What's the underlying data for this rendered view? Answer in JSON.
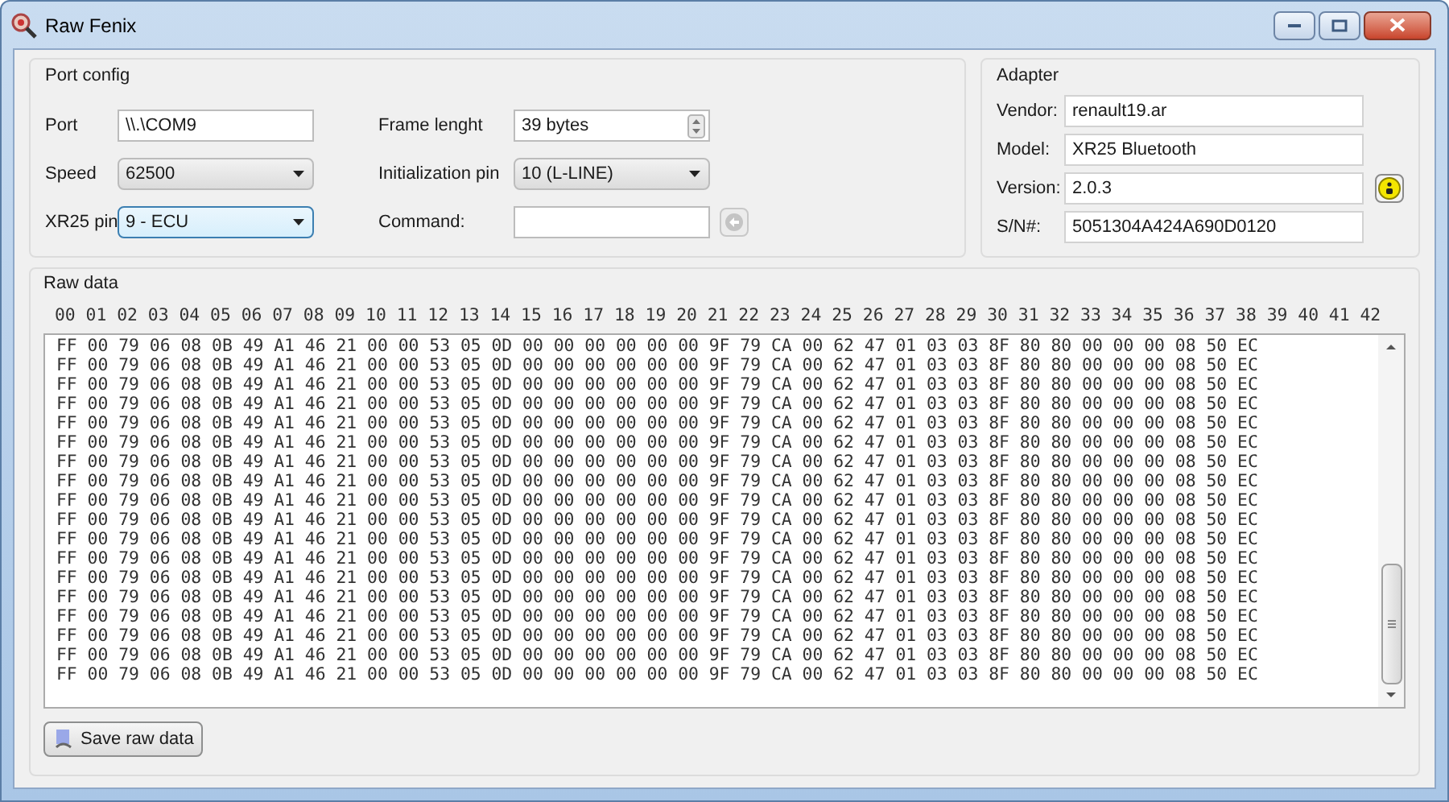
{
  "window": {
    "title": "Raw Fenix"
  },
  "port_config": {
    "title": "Port config",
    "fields": [
      {
        "label": "Port",
        "kind": "text",
        "value": "\\\\.\\COM9",
        "focused": false
      },
      {
        "label": "Frame lenght",
        "kind": "spin",
        "value": "39 bytes",
        "focused": false
      },
      {
        "label": "Speed",
        "kind": "dropdown",
        "value": "62500",
        "focused": false
      },
      {
        "label": "Initialization pin",
        "kind": "dropdown",
        "value": "10 (L-LINE)",
        "focused": false
      },
      {
        "label": "XR25 pin",
        "kind": "dropdown",
        "value": "9 - ECU",
        "focused": true
      },
      {
        "label": "Command:",
        "kind": "command",
        "focused": false,
        "disabled": true
      }
    ]
  },
  "adapter": {
    "title": "Adapter",
    "fields": [
      {
        "label": "Vendor:",
        "value": "renault19.ar"
      },
      {
        "label": "Model:",
        "value": "XR25 Bluetooth"
      },
      {
        "label": "Version:",
        "value": "2.0.3"
      },
      {
        "label": "S/N#:",
        "value": "5051304A424A690D0120"
      }
    ]
  },
  "raw_data": {
    "title": "Raw data",
    "header": "00 01 02 03 04 05 06 07 08 09 10 11 12 13 14 15 16 17 18 19 20 21 22 23 24 25 26 27 28 29 30 31 32 33 34 35 36 37 38 39 40 41 42",
    "rows": [
      "FF 00 79 06 08 0B 49 A1 46 21 00 00 53 05 0D 00 00 00 00 00 00 9F 79 CA 00 62 47 01 03 03 8F 80 80 00 00 00 08 50 EC",
      "FF 00 79 06 08 0B 49 A1 46 21 00 00 53 05 0D 00 00 00 00 00 00 9F 79 CA 00 62 47 01 03 03 8F 80 80 00 00 00 08 50 EC",
      "FF 00 79 06 08 0B 49 A1 46 21 00 00 53 05 0D 00 00 00 00 00 00 9F 79 CA 00 62 47 01 03 03 8F 80 80 00 00 00 08 50 EC",
      "FF 00 79 06 08 0B 49 A1 46 21 00 00 53 05 0D 00 00 00 00 00 00 9F 79 CA 00 62 47 01 03 03 8F 80 80 00 00 00 08 50 EC",
      "FF 00 79 06 08 0B 49 A1 46 21 00 00 53 05 0D 00 00 00 00 00 00 9F 79 CA 00 62 47 01 03 03 8F 80 80 00 00 00 08 50 EC",
      "FF 00 79 06 08 0B 49 A1 46 21 00 00 53 05 0D 00 00 00 00 00 00 9F 79 CA 00 62 47 01 03 03 8F 80 80 00 00 00 08 50 EC",
      "FF 00 79 06 08 0B 49 A1 46 21 00 00 53 05 0D 00 00 00 00 00 00 9F 79 CA 00 62 47 01 03 03 8F 80 80 00 00 00 08 50 EC",
      "FF 00 79 06 08 0B 49 A1 46 21 00 00 53 05 0D 00 00 00 00 00 00 9F 79 CA 00 62 47 01 03 03 8F 80 80 00 00 00 08 50 EC",
      "FF 00 79 06 08 0B 49 A1 46 21 00 00 53 05 0D 00 00 00 00 00 00 9F 79 CA 00 62 47 01 03 03 8F 80 80 00 00 00 08 50 EC",
      "FF 00 79 06 08 0B 49 A1 46 21 00 00 53 05 0D 00 00 00 00 00 00 9F 79 CA 00 62 47 01 03 03 8F 80 80 00 00 00 08 50 EC",
      "FF 00 79 06 08 0B 49 A1 46 21 00 00 53 05 0D 00 00 00 00 00 00 9F 79 CA 00 62 47 01 03 03 8F 80 80 00 00 00 08 50 EC",
      "FF 00 79 06 08 0B 49 A1 46 21 00 00 53 05 0D 00 00 00 00 00 00 9F 79 CA 00 62 47 01 03 03 8F 80 80 00 00 00 08 50 EC",
      "FF 00 79 06 08 0B 49 A1 46 21 00 00 53 05 0D 00 00 00 00 00 00 9F 79 CA 00 62 47 01 03 03 8F 80 80 00 00 00 08 50 EC",
      "FF 00 79 06 08 0B 49 A1 46 21 00 00 53 05 0D 00 00 00 00 00 00 9F 79 CA 00 62 47 01 03 03 8F 80 80 00 00 00 08 50 EC",
      "FF 00 79 06 08 0B 49 A1 46 21 00 00 53 05 0D 00 00 00 00 00 00 9F 79 CA 00 62 47 01 03 03 8F 80 80 00 00 00 08 50 EC",
      "FF 00 79 06 08 0B 49 A1 46 21 00 00 53 05 0D 00 00 00 00 00 00 9F 79 CA 00 62 47 01 03 03 8F 80 80 00 00 00 08 50 EC",
      "FF 00 79 06 08 0B 49 A1 46 21 00 00 53 05 0D 00 00 00 00 00 00 9F 79 CA 00 62 47 01 03 03 8F 80 80 00 00 00 08 50 EC",
      "FF 00 79 06 08 0B 49 A1 46 21 00 00 53 05 0D 00 00 00 00 00 00 9F 79 CA 00 62 47 01 03 03 8F 80 80 00 00 00 08 50 EC"
    ]
  },
  "save_button": {
    "label": "Save raw data"
  }
}
